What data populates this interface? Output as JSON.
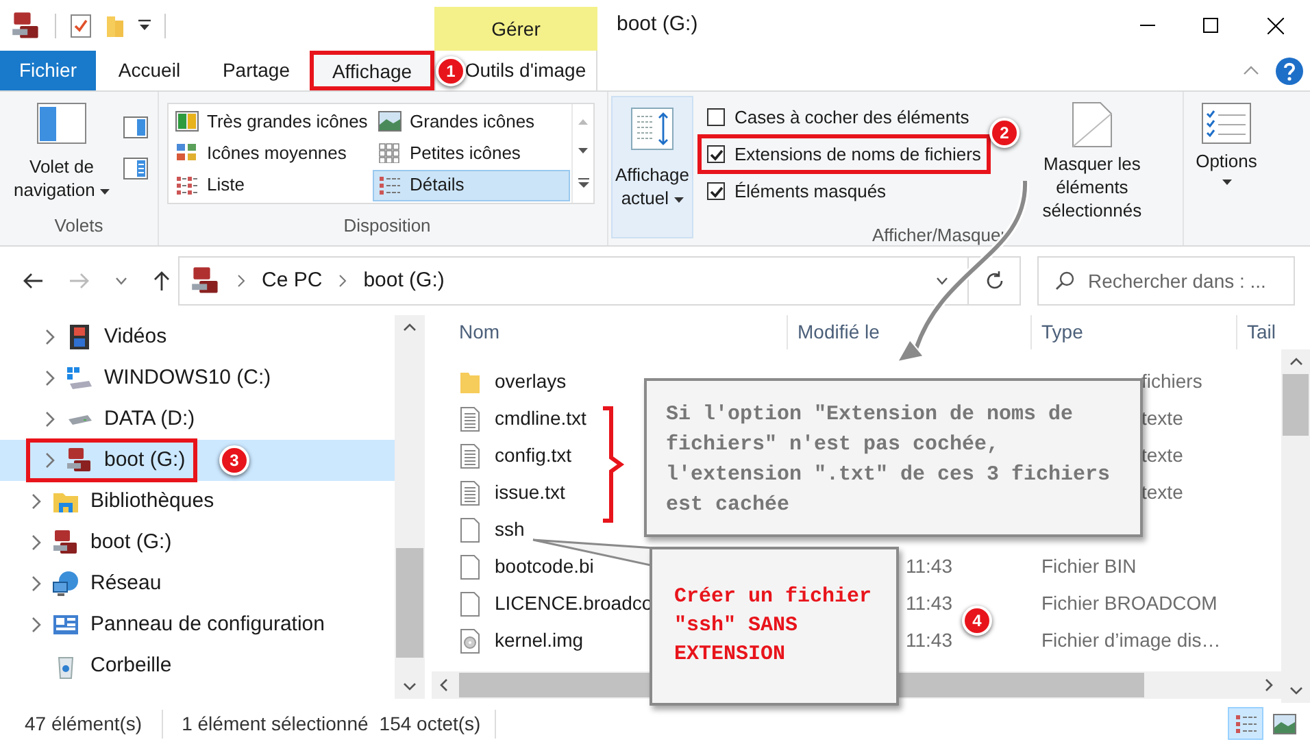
{
  "title_bar": {
    "contextual_tab": "Gérer",
    "title": "boot (G:)"
  },
  "ribbon_tabs": [
    {
      "label": "Fichier",
      "kind": "file",
      "selected": false,
      "highlighted": false
    },
    {
      "label": "Accueil",
      "kind": "tab",
      "selected": false,
      "highlighted": false
    },
    {
      "label": "Partage",
      "kind": "tab",
      "selected": false,
      "highlighted": false
    },
    {
      "label": "Affichage",
      "kind": "tab",
      "selected": true,
      "highlighted": true
    },
    {
      "label": "Outils d'image",
      "kind": "contextual",
      "selected": false,
      "highlighted": false
    }
  ],
  "ribbon": {
    "panes": {
      "label": "Volets",
      "nav_pane_button": "Volet de navigation"
    },
    "layout": {
      "label": "Disposition",
      "options": [
        {
          "label": "Très grandes icônes",
          "kind": "xl",
          "selected": false
        },
        {
          "label": "Grandes icônes",
          "kind": "large",
          "selected": false
        },
        {
          "label": "Icônes moyennes",
          "kind": "medium",
          "selected": false
        },
        {
          "label": "Petites icônes",
          "kind": "small",
          "selected": false
        },
        {
          "label": "Liste",
          "kind": "list",
          "selected": false
        },
        {
          "label": "Détails",
          "kind": "details",
          "selected": true
        }
      ]
    },
    "current_view": {
      "label": "Affichage actuel"
    },
    "show_hide": {
      "label": "Afficher/Masquer",
      "checkboxes": [
        {
          "label": "Cases à cocher des éléments",
          "checked": false,
          "highlighted": false
        },
        {
          "label": "Extensions de noms de fichiers",
          "checked": true,
          "highlighted": true
        },
        {
          "label": "Éléments masqués",
          "checked": true,
          "highlighted": false
        }
      ],
      "hide_selected": "Masquer les éléments sélectionnés"
    },
    "options": {
      "label": "Options"
    }
  },
  "address_bar": {
    "path": [
      "Ce PC",
      "boot (G:)"
    ],
    "search_placeholder": "Rechercher dans : ..."
  },
  "nav_pane": {
    "this_pc_children": [
      {
        "label": "Vidéos",
        "kind": "videos",
        "selected": false,
        "highlighted": false
      },
      {
        "label": "WINDOWS10 (C:)",
        "kind": "windows-drive",
        "selected": false,
        "highlighted": false
      },
      {
        "label": "DATA (D:)",
        "kind": "drive",
        "selected": false,
        "highlighted": false
      },
      {
        "label": "boot (G:)",
        "kind": "sd",
        "selected": true,
        "highlighted": true
      }
    ],
    "items": [
      {
        "label": "Bibliothèques",
        "kind": "libraries",
        "expandable": true
      },
      {
        "label": "boot (G:)",
        "kind": "sd",
        "expandable": true
      },
      {
        "label": "Réseau",
        "kind": "network",
        "expandable": true
      },
      {
        "label": "Panneau de configuration",
        "kind": "control-panel",
        "expandable": true
      },
      {
        "label": "Corbeille",
        "kind": "recycle",
        "expandable": false
      }
    ]
  },
  "file_list": {
    "columns": [
      "Nom",
      "Modifié le",
      "Type",
      "Tail"
    ],
    "rows": [
      {
        "name": "overlays",
        "kind": "folder",
        "modified": "",
        "type": "fichiers"
      },
      {
        "name": "cmdline.txt",
        "kind": "text",
        "modified": "",
        "type": "texte"
      },
      {
        "name": "config.txt",
        "kind": "text",
        "modified": "",
        "type": "texte"
      },
      {
        "name": "issue.txt",
        "kind": "text",
        "modified": "",
        "type": "texte"
      },
      {
        "name": "ssh",
        "kind": "blank",
        "modified": "",
        "type": ""
      },
      {
        "name": "bootcode.bi",
        "kind": "blank",
        "modified": "11:43",
        "type": "Fichier BIN"
      },
      {
        "name": "LICENCE.broadco",
        "kind": "blank",
        "modified": "11:43",
        "type": "Fichier BROADCOM"
      },
      {
        "name": "kernel.img",
        "kind": "disc",
        "modified": "11:43",
        "type": "Fichier d’image dis…"
      }
    ]
  },
  "status_bar": {
    "item_count": "47 élément(s)",
    "selection": "1 élément sélectionné",
    "size": "154 octet(s)",
    "views": [
      {
        "kind": "details",
        "selected": true
      },
      {
        "kind": "thumbnails",
        "selected": false
      }
    ]
  },
  "annotations": {
    "badges": [
      "1",
      "2",
      "3",
      "4"
    ],
    "note": "Si l'option \"Extension de noms de fichiers\" n'est pas cochée, l'extension \".txt\" de ces 3 fichiers est cachée",
    "callout": "Créer un fichier \"ssh\" SANS EXTENSION"
  }
}
